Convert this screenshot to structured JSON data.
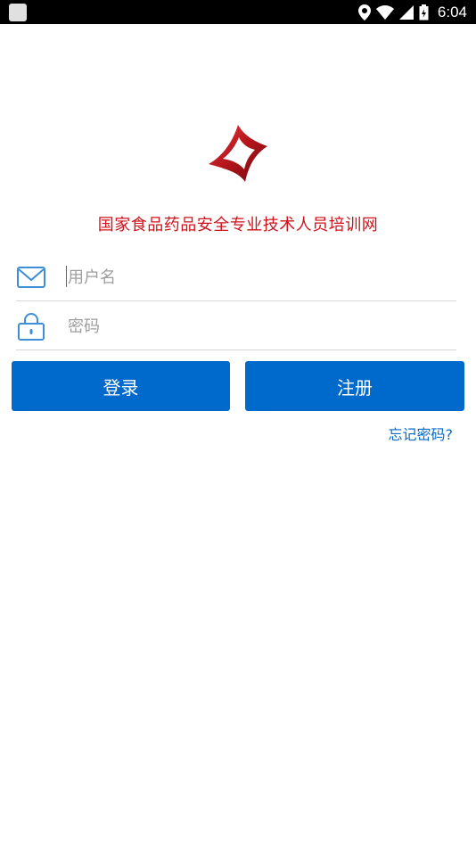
{
  "status_bar": {
    "time": "6:04"
  },
  "app": {
    "title": "国家食品药品安全专业技术人员培训网"
  },
  "login": {
    "username_placeholder": "用户名",
    "password_placeholder": "密码",
    "login_label": "登录",
    "register_label": "注册",
    "forgot_label": "忘记密码?"
  },
  "colors": {
    "brand_red": "#d0121a",
    "primary_blue": "#0069cc"
  }
}
